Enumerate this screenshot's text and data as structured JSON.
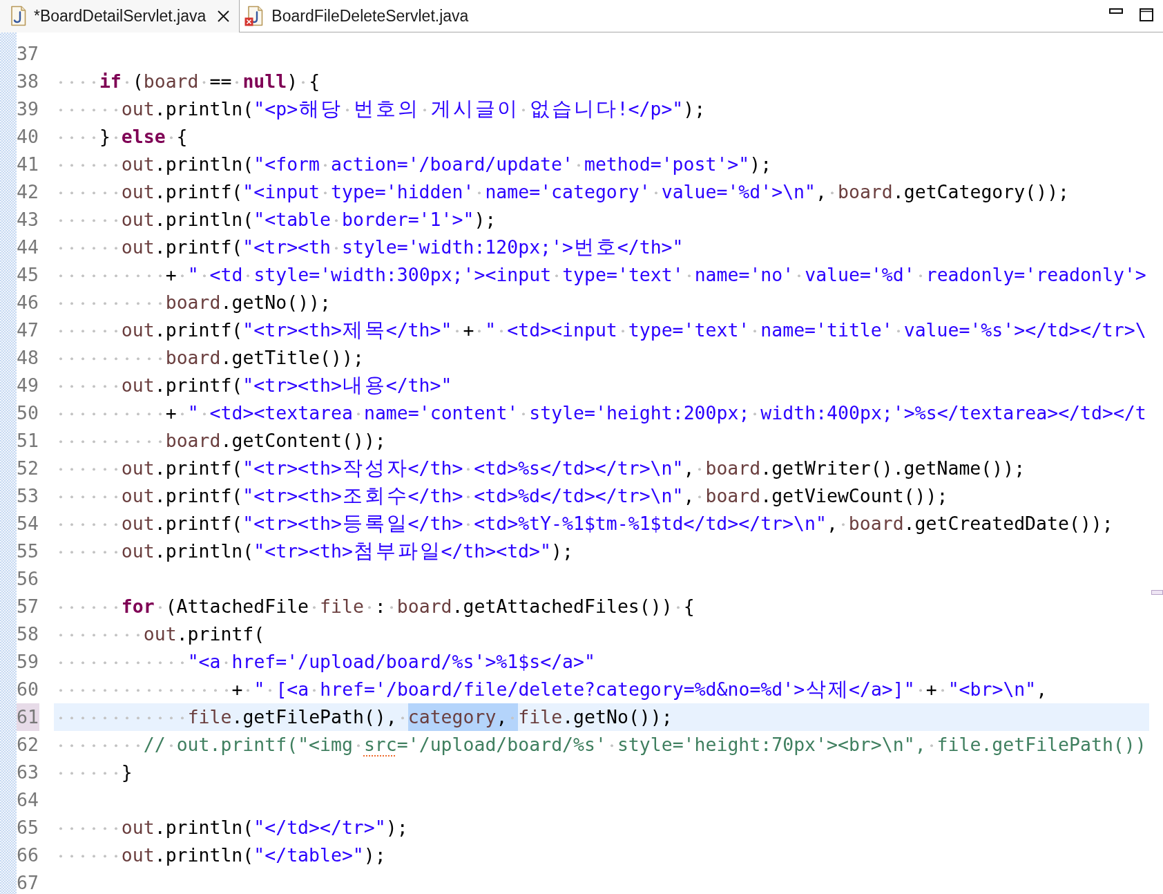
{
  "tabs": [
    {
      "label": "*BoardDetailServlet.java",
      "selected": true,
      "error": false,
      "closable": true
    },
    {
      "label": "BoardFileDeleteServlet.java",
      "selected": false,
      "error": true,
      "closable": false
    }
  ],
  "editor": {
    "lines": [
      {
        "number": "37",
        "current": false
      },
      {
        "number": "38",
        "current": false,
        "tokens": [
          {
            "text": "    if",
            "kind": "keyword"
          },
          {
            "text": " (",
            "kind": "plain"
          },
          {
            "text": "board",
            "kind": "variable"
          },
          {
            "text": " == ",
            "kind": "plain"
          },
          {
            "text": "null",
            "kind": "keyword"
          },
          {
            "text": ") {",
            "kind": "plain"
          }
        ]
      },
      {
        "number": "39",
        "current": false,
        "tokens": [
          {
            "text": "      out",
            "kind": "variable"
          },
          {
            "text": ".println(",
            "kind": "plain"
          },
          {
            "text": "\"<p>해당 번호의 게시글이 없습니다!</p>\"",
            "kind": "string"
          },
          {
            "text": ");",
            "kind": "plain"
          }
        ]
      },
      {
        "number": "40",
        "current": false,
        "tokens": [
          {
            "text": "    } ",
            "kind": "plain"
          },
          {
            "text": "else",
            "kind": "keyword"
          },
          {
            "text": " {",
            "kind": "plain"
          }
        ]
      },
      {
        "number": "41",
        "current": false,
        "tokens": [
          {
            "text": "      out",
            "kind": "variable"
          },
          {
            "text": ".println(",
            "kind": "plain"
          },
          {
            "text": "\"<form action='/board/update' method='post'>\"",
            "kind": "string"
          },
          {
            "text": ");",
            "kind": "plain"
          }
        ]
      },
      {
        "number": "42",
        "current": false,
        "tokens": [
          {
            "text": "      out",
            "kind": "variable"
          },
          {
            "text": ".printf(",
            "kind": "plain"
          },
          {
            "text": "\"<input type='hidden' name='category' value='%d'>\\n\"",
            "kind": "string"
          },
          {
            "text": ", ",
            "kind": "plain"
          },
          {
            "text": "board",
            "kind": "variable"
          },
          {
            "text": ".getCategory());",
            "kind": "plain"
          }
        ]
      },
      {
        "number": "43",
        "current": false,
        "tokens": [
          {
            "text": "      out",
            "kind": "variable"
          },
          {
            "text": ".println(",
            "kind": "plain"
          },
          {
            "text": "\"<table border='1'>\"",
            "kind": "string"
          },
          {
            "text": ");",
            "kind": "plain"
          }
        ]
      },
      {
        "number": "44",
        "current": false,
        "tokens": [
          {
            "text": "      out",
            "kind": "variable"
          },
          {
            "text": ".printf(",
            "kind": "plain"
          },
          {
            "text": "\"<tr><th style='width:120px;'>번호</th>\"",
            "kind": "string"
          }
        ]
      },
      {
        "number": "45",
        "current": false,
        "tokens": [
          {
            "text": "          + ",
            "kind": "plain"
          },
          {
            "text": "\" <td style='width:300px;'><input type='text' name='no' value='%d' readonly='readonly'>",
            "kind": "string"
          }
        ]
      },
      {
        "number": "46",
        "current": false,
        "tokens": [
          {
            "text": "          board",
            "kind": "variable"
          },
          {
            "text": ".getNo());",
            "kind": "plain"
          }
        ]
      },
      {
        "number": "47",
        "current": false,
        "tokens": [
          {
            "text": "      out",
            "kind": "variable"
          },
          {
            "text": ".printf(",
            "kind": "plain"
          },
          {
            "text": "\"<tr><th>제목</th>\"",
            "kind": "string"
          },
          {
            "text": " + ",
            "kind": "plain"
          },
          {
            "text": "\" <td><input type='text' name='title' value='%s'></td></tr>\\",
            "kind": "string"
          }
        ]
      },
      {
        "number": "48",
        "current": false,
        "tokens": [
          {
            "text": "          board",
            "kind": "variable"
          },
          {
            "text": ".getTitle());",
            "kind": "plain"
          }
        ]
      },
      {
        "number": "49",
        "current": false,
        "tokens": [
          {
            "text": "      out",
            "kind": "variable"
          },
          {
            "text": ".printf(",
            "kind": "plain"
          },
          {
            "text": "\"<tr><th>내용</th>\"",
            "kind": "string"
          }
        ]
      },
      {
        "number": "50",
        "current": false,
        "tokens": [
          {
            "text": "          + ",
            "kind": "plain"
          },
          {
            "text": "\" <td><textarea name='content' style='height:200px; width:400px;'>%s</textarea></td></t",
            "kind": "string"
          }
        ]
      },
      {
        "number": "51",
        "current": false,
        "tokens": [
          {
            "text": "          board",
            "kind": "variable"
          },
          {
            "text": ".getContent());",
            "kind": "plain"
          }
        ]
      },
      {
        "number": "52",
        "current": false,
        "tokens": [
          {
            "text": "      out",
            "kind": "variable"
          },
          {
            "text": ".printf(",
            "kind": "plain"
          },
          {
            "text": "\"<tr><th>작성자</th> <td>%s</td></tr>\\n\"",
            "kind": "string"
          },
          {
            "text": ", ",
            "kind": "plain"
          },
          {
            "text": "board",
            "kind": "variable"
          },
          {
            "text": ".getWriter().getName());",
            "kind": "plain"
          }
        ]
      },
      {
        "number": "53",
        "current": false,
        "tokens": [
          {
            "text": "      out",
            "kind": "variable"
          },
          {
            "text": ".printf(",
            "kind": "plain"
          },
          {
            "text": "\"<tr><th>조회수</th> <td>%d</td></tr>\\n\"",
            "kind": "string"
          },
          {
            "text": ", ",
            "kind": "plain"
          },
          {
            "text": "board",
            "kind": "variable"
          },
          {
            "text": ".getViewCount());",
            "kind": "plain"
          }
        ]
      },
      {
        "number": "54",
        "current": false,
        "tokens": [
          {
            "text": "      out",
            "kind": "variable"
          },
          {
            "text": ".printf(",
            "kind": "plain"
          },
          {
            "text": "\"<tr><th>등록일</th> <td>%tY-%1$tm-%1$td</td></tr>\\n\"",
            "kind": "string"
          },
          {
            "text": ", ",
            "kind": "plain"
          },
          {
            "text": "board",
            "kind": "variable"
          },
          {
            "text": ".getCreatedDate());",
            "kind": "plain"
          }
        ]
      },
      {
        "number": "55",
        "current": false,
        "tokens": [
          {
            "text": "      out",
            "kind": "variable"
          },
          {
            "text": ".println(",
            "kind": "plain"
          },
          {
            "text": "\"<tr><th>첨부파일</th><td>\"",
            "kind": "string"
          },
          {
            "text": ");",
            "kind": "plain"
          }
        ]
      },
      {
        "number": "56",
        "current": false
      },
      {
        "number": "57",
        "current": false,
        "tokens": [
          {
            "text": "      for",
            "kind": "keyword"
          },
          {
            "text": " (AttachedFile ",
            "kind": "plain"
          },
          {
            "text": "file",
            "kind": "variable"
          },
          {
            "text": " : ",
            "kind": "plain"
          },
          {
            "text": "board",
            "kind": "variable"
          },
          {
            "text": ".getAttachedFiles()) {",
            "kind": "plain"
          }
        ]
      },
      {
        "number": "58",
        "current": false,
        "tokens": [
          {
            "text": "        out",
            "kind": "variable"
          },
          {
            "text": ".printf(",
            "kind": "plain"
          }
        ]
      },
      {
        "number": "59",
        "current": false,
        "tokens": [
          {
            "text": "            \"<a href='/upload/board/%s'>%1$s</a>\"",
            "kind": "string"
          }
        ]
      },
      {
        "number": "60",
        "current": false,
        "tokens": [
          {
            "text": "                + ",
            "kind": "plain"
          },
          {
            "text": "\" [<a href='/board/file/delete?category=%d&no=%d'>삭제</a>]\"",
            "kind": "string"
          },
          {
            "text": " + ",
            "kind": "plain"
          },
          {
            "text": "\"<br>\\n\"",
            "kind": "string"
          },
          {
            "text": ",",
            "kind": "plain"
          }
        ]
      },
      {
        "number": "61",
        "current": true,
        "tokens": [
          {
            "text": "            file",
            "kind": "variable",
            "selected": false
          },
          {
            "text": ".getFilePath(), ",
            "kind": "plain",
            "selected": false
          },
          {
            "text": "category",
            "kind": "variable",
            "selected": true
          },
          {
            "text": ", ",
            "kind": "plain",
            "selected": true
          },
          {
            "text": "file",
            "kind": "variable",
            "selected": false
          },
          {
            "text": ".getNo());",
            "kind": "plain",
            "selected": false
          }
        ]
      },
      {
        "number": "62",
        "current": false,
        "tokens": [
          {
            "text": "        // out.printf(\"<img ",
            "kind": "comment",
            "misspelled": false
          },
          {
            "text": "src",
            "kind": "comment",
            "misspelled": true
          },
          {
            "text": "='/upload/board/%s' style='height:70px'><br>\\n\", file.getFilePath())",
            "kind": "comment",
            "misspelled": false
          }
        ]
      },
      {
        "number": "63",
        "current": false,
        "tokens": [
          {
            "text": "      }",
            "kind": "plain"
          }
        ]
      },
      {
        "number": "64",
        "current": false
      },
      {
        "number": "65",
        "current": false,
        "tokens": [
          {
            "text": "      out",
            "kind": "variable"
          },
          {
            "text": ".println(",
            "kind": "plain"
          },
          {
            "text": "\"</td></tr>\"",
            "kind": "string"
          },
          {
            "text": ");",
            "kind": "plain"
          }
        ]
      },
      {
        "number": "66",
        "current": false,
        "tokens": [
          {
            "text": "      out",
            "kind": "variable"
          },
          {
            "text": ".println(",
            "kind": "plain"
          },
          {
            "text": "\"</table>\"",
            "kind": "string"
          },
          {
            "text": ");",
            "kind": "plain"
          }
        ]
      },
      {
        "number": "67",
        "current": false
      }
    ]
  }
}
